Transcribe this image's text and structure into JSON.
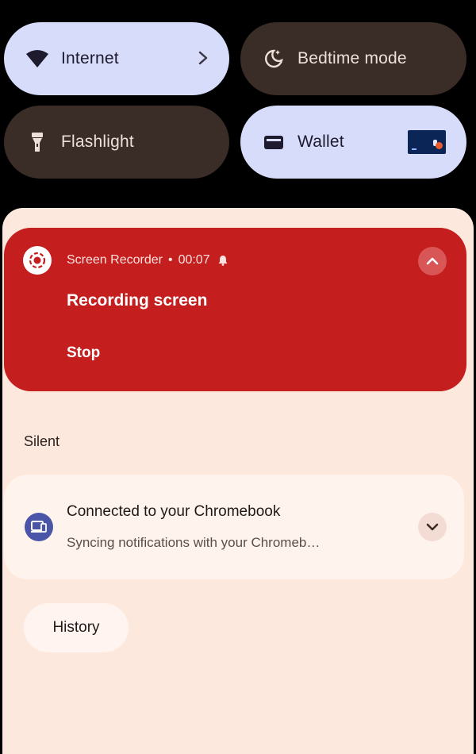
{
  "quick_tiles": {
    "internet": {
      "label": "Internet",
      "icon": "wifi-icon",
      "state": "on"
    },
    "bedtime": {
      "label": "Bedtime mode",
      "icon": "bedtime-moon-icon",
      "state": "off"
    },
    "flashlight": {
      "label": "Flashlight",
      "icon": "flashlight-icon",
      "state": "off"
    },
    "wallet": {
      "label": "Wallet",
      "icon": "wallet-icon",
      "state": "on"
    }
  },
  "recorder": {
    "app_name": "Screen Recorder",
    "separator": "•",
    "elapsed": "00:07",
    "title": "Recording screen",
    "action": "Stop",
    "accent": "#c41e1f"
  },
  "silent_section": {
    "label": "Silent"
  },
  "chromebook_notification": {
    "title": "Connected to your Chromebook",
    "text": "Syncing notifications with your Chromeb…",
    "icon": "laptop-icon"
  },
  "history_button": {
    "label": "History"
  },
  "colors": {
    "tile_on": "#d7dcfb",
    "tile_off": "#3a2c26",
    "shade_bg": "#fde8de"
  }
}
